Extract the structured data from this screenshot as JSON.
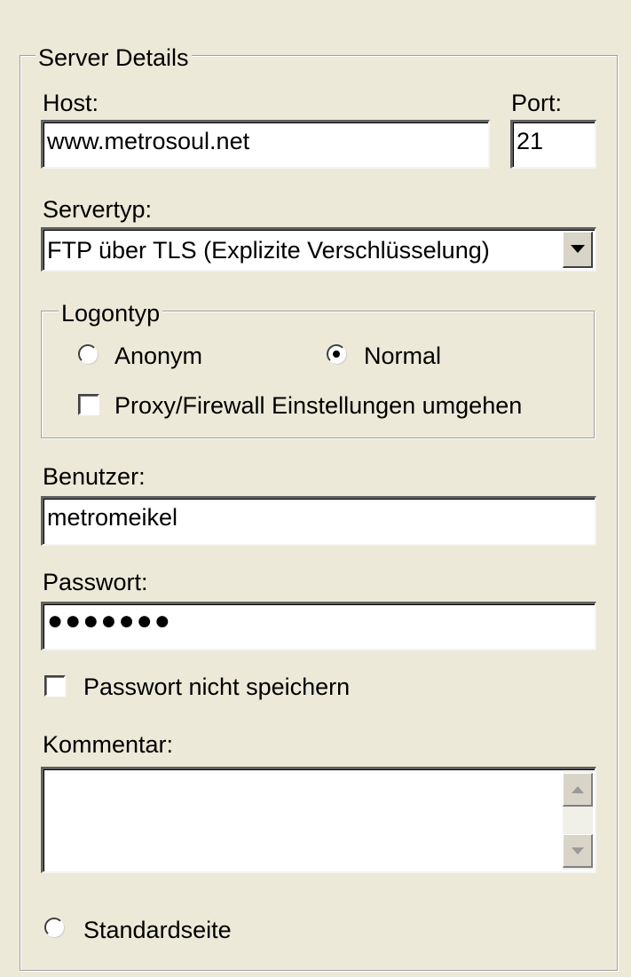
{
  "server_details": {
    "legend": "Server Details",
    "host_label": "Host:",
    "host_value": "www.metrosoul.net",
    "port_label": "Port:",
    "port_value": "21",
    "servertype_label": "Servertyp:",
    "servertype_value": "FTP über TLS (Explizite Verschlüsselung)"
  },
  "logontype": {
    "legend": "Logontyp",
    "option_anonymous": "Anonym",
    "option_normal": "Normal",
    "selected": "Normal",
    "bypass_proxy_label": "Proxy/Firewall Einstellungen umgehen",
    "bypass_proxy_checked": false
  },
  "credentials": {
    "user_label": "Benutzer:",
    "user_value": "metromeikel",
    "password_label": "Passwort:",
    "password_masked": "●●●●●●●",
    "dont_save_password_label": "Passwort nicht speichern",
    "dont_save_password_checked": false
  },
  "comment": {
    "label": "Kommentar:",
    "value": ""
  },
  "default_site": {
    "label": "Standardseite",
    "selected": false
  },
  "icons": {
    "combo_arrow": "chevron-down-icon",
    "scroll_up": "scroll-up-arrow-icon",
    "scroll_down": "scroll-down-arrow-icon"
  }
}
